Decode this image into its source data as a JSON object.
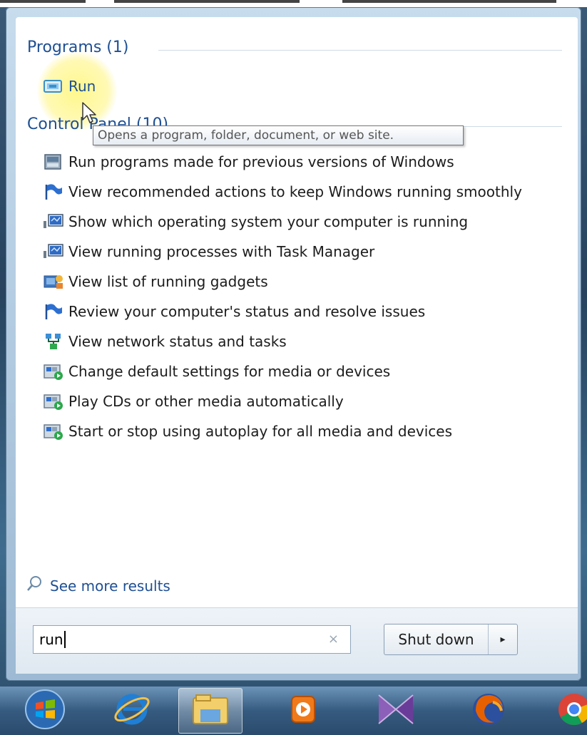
{
  "programs": {
    "heading": "Programs (1)",
    "items": [
      {
        "label": "Run",
        "icon": "run-icon"
      }
    ]
  },
  "control_panel": {
    "heading": "Control Panel (10)",
    "items": [
      {
        "label": "Run programs made for previous versions of Windows",
        "icon": "compat-icon"
      },
      {
        "label": "View recommended actions to keep Windows running smoothly",
        "icon": "action-center-flag-icon"
      },
      {
        "label": "Show which operating system your computer is running",
        "icon": "system-icon"
      },
      {
        "label": "View running processes with Task Manager",
        "icon": "system-icon"
      },
      {
        "label": "View list of running gadgets",
        "icon": "gadgets-icon"
      },
      {
        "label": "Review your computer's status and resolve issues",
        "icon": "action-center-flag-icon"
      },
      {
        "label": "View network status and tasks",
        "icon": "network-icon"
      },
      {
        "label": "Change default settings for media or devices",
        "icon": "autoplay-icon"
      },
      {
        "label": "Play CDs or other media automatically",
        "icon": "autoplay-icon"
      },
      {
        "label": "Start or stop using autoplay for all media and devices",
        "icon": "autoplay-icon"
      }
    ]
  },
  "tooltip": "Opens a program, folder, document, or web site.",
  "see_more": "See more results",
  "search": {
    "value": "run",
    "clear": "×"
  },
  "shutdown": {
    "label": "Shut down",
    "arrow": "▸"
  },
  "taskbar": [
    "start-orb-icon",
    "internet-explorer-icon",
    "file-explorer-icon",
    "media-player-icon",
    "visual-studio-icon",
    "firefox-icon",
    "chrome-icon"
  ]
}
